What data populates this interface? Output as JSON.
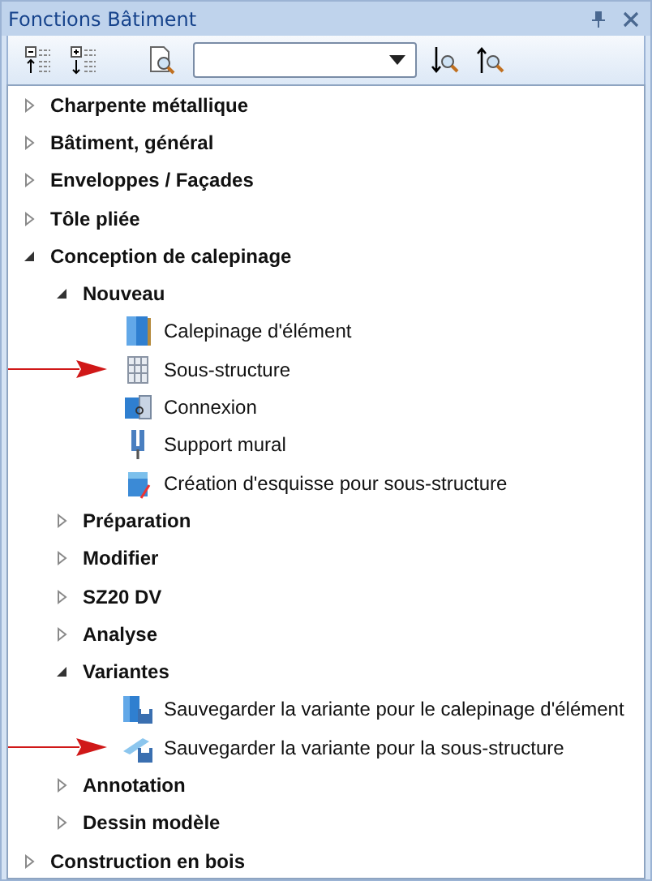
{
  "window": {
    "title": "Fonctions Bâtiment"
  },
  "tree": [
    {
      "label": "Charpente métallique",
      "expanded": false
    },
    {
      "label": "Bâtiment, général",
      "expanded": false
    },
    {
      "label": "Enveloppes / Façades",
      "expanded": false
    },
    {
      "label": "Tôle pliée",
      "expanded": false
    },
    {
      "label": "Conception de calepinage",
      "expanded": true,
      "children": [
        {
          "label": "Nouveau",
          "expanded": true,
          "children": [
            {
              "label": "Calepinage d'élément",
              "arrow": false
            },
            {
              "label": "Sous-structure",
              "arrow": true
            },
            {
              "label": "Connexion",
              "arrow": false
            },
            {
              "label": "Support mural",
              "arrow": false
            },
            {
              "label": "Création d'esquisse pour sous-structure",
              "arrow": false
            }
          ]
        },
        {
          "label": "Préparation",
          "expanded": false
        },
        {
          "label": "Modifier",
          "expanded": false
        },
        {
          "label": "SZ20 DV",
          "expanded": false
        },
        {
          "label": "Analyse",
          "expanded": false
        },
        {
          "label": "Variantes",
          "expanded": true,
          "children": [
            {
              "label": "Sauvegarder la variante pour le calepinage d'élément",
              "arrow": false
            },
            {
              "label": "Sauvegarder la variante pour la sous-structure",
              "arrow": true
            }
          ]
        },
        {
          "label": "Annotation",
          "expanded": false
        },
        {
          "label": "Dessin modèle",
          "expanded": false
        }
      ]
    },
    {
      "label": "Construction en bois",
      "expanded": false
    }
  ]
}
